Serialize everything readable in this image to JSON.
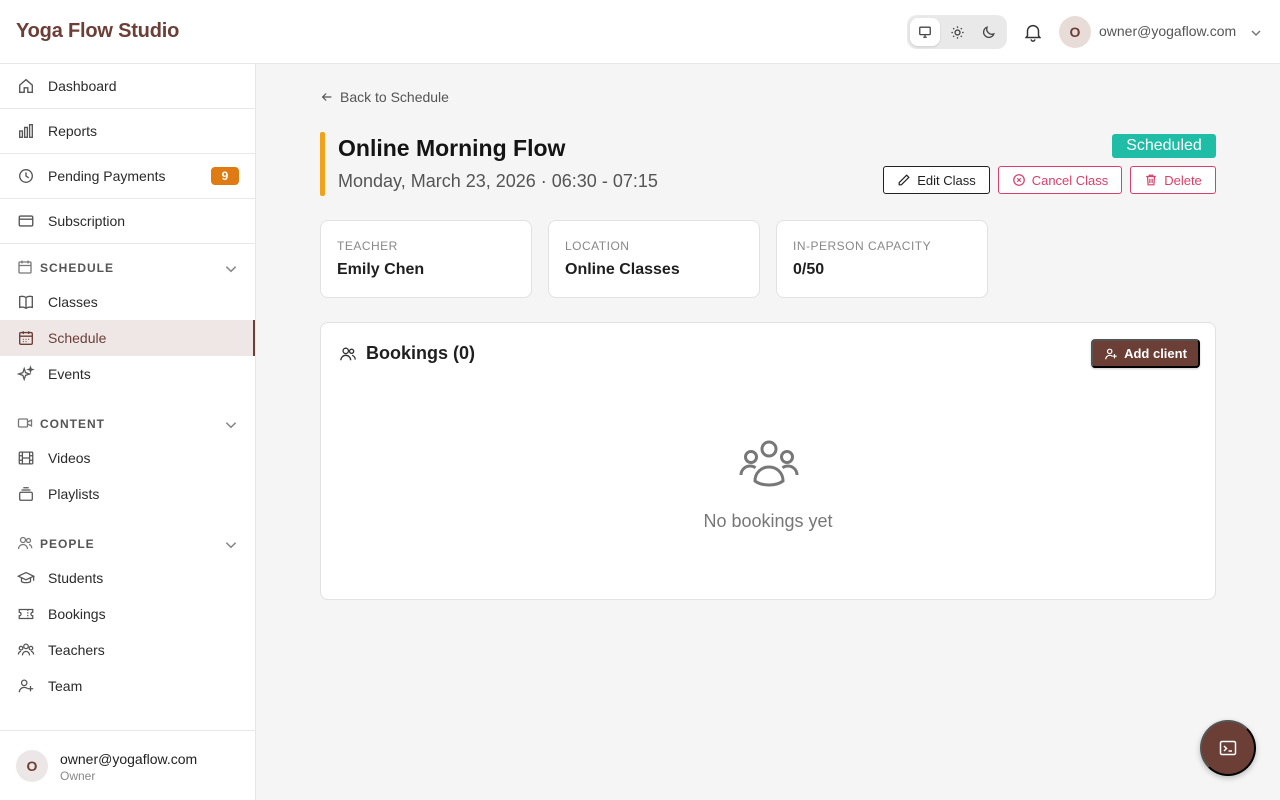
{
  "app": {
    "brand": "Yoga Flow Studio"
  },
  "header": {
    "theme_options": [
      "system-icon",
      "sun-icon",
      "moon-icon"
    ],
    "user_initial": "O",
    "user_email": "owner@yogaflow.com"
  },
  "sidebar": {
    "items": [
      {
        "label": "Dashboard",
        "icon": "home-icon"
      },
      {
        "label": "Reports",
        "icon": "bar-chart-icon"
      },
      {
        "label": "Pending Payments",
        "icon": "clock-icon",
        "badge": "9"
      },
      {
        "label": "Subscription",
        "icon": "credit-card-icon"
      }
    ],
    "sections": [
      {
        "title": "SCHEDULE",
        "items": [
          "Classes",
          "Schedule",
          "Events"
        ],
        "active": "Schedule"
      },
      {
        "title": "CONTENT",
        "items": [
          "Videos",
          "Playlists"
        ]
      },
      {
        "title": "PEOPLE",
        "items": [
          "Students",
          "Bookings",
          "Teachers",
          "Team"
        ]
      }
    ],
    "user": {
      "initial": "O",
      "email": "owner@yogaflow.com",
      "role": "Owner"
    }
  },
  "page": {
    "back_label": "Back to Schedule",
    "title": "Online Morning Flow",
    "when": "Monday, March 23, 2026 · 06:30 - 07:15",
    "status": "Scheduled",
    "actions": {
      "edit": "Edit Class",
      "cancel": "Cancel Class",
      "delete": "Delete"
    },
    "info": [
      {
        "key": "TEACHER",
        "value": "Emily Chen"
      },
      {
        "key": "LOCATION",
        "value": "Online Classes"
      },
      {
        "key": "IN-PERSON CAPACITY",
        "value": "0/50"
      }
    ],
    "bookings": {
      "title": "Bookings (0)",
      "add_label": "Add client",
      "empty_text": "No bookings yet"
    }
  },
  "colors": {
    "brand": "#6b3e36",
    "status": "#1fbda6",
    "danger": "#d93f6a",
    "accent": "#f0a21a",
    "badge": "#e07a12"
  }
}
